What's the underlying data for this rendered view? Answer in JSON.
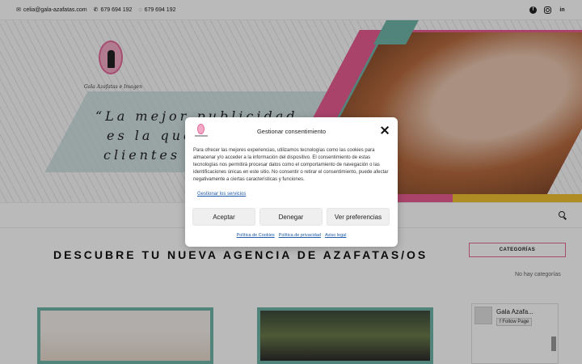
{
  "topbar": {
    "email": "celia@gala-azafatas.com",
    "phone": "679 694 192",
    "whatsapp": "679 694 192",
    "social_icons": [
      "facebook-icon",
      "instagram-icon",
      "linkedin-icon"
    ]
  },
  "hero": {
    "logo_text": "Gala Azafatas e Imagen",
    "quote_line1": "“La mejor publicidad",
    "quote_line2": "es la que",
    "quote_line3": "clientes s"
  },
  "main": {
    "headline": "DESCUBRE TU NUEVA AGENCIA DE AZAFATAS/OS"
  },
  "sidebar": {
    "categories_title": "CATEGORÍAS",
    "no_categories": "No hay categorías",
    "fb_page_name": "Gala Azafa...",
    "fb_follow": "Follow Page"
  },
  "consent": {
    "title": "Gestionar consentimiento",
    "body": "Para ofrecer las mejores experiencias, utilizamos tecnologías como las cookies para almacenar y/o acceder a la información del dispositivo. El consentimiento de estas tecnologías nos permitirá procesar datos como el comportamiento de navegación o las identificaciones únicas en este sitio. No consentir o retirar el consentimiento, puede afectar negativamente a ciertas características y funciones.",
    "manage_services": "Gestionar los servicios",
    "accept": "Aceptar",
    "deny": "Denegar",
    "preferences": "Ver preferencias",
    "links": [
      "Política de Cookies",
      "Política de privacidad",
      "Aviso legal"
    ]
  },
  "colors": {
    "accent_pink": "#e85c92",
    "accent_teal": "#6fb5a8",
    "link_blue": "#1e5aa8"
  }
}
